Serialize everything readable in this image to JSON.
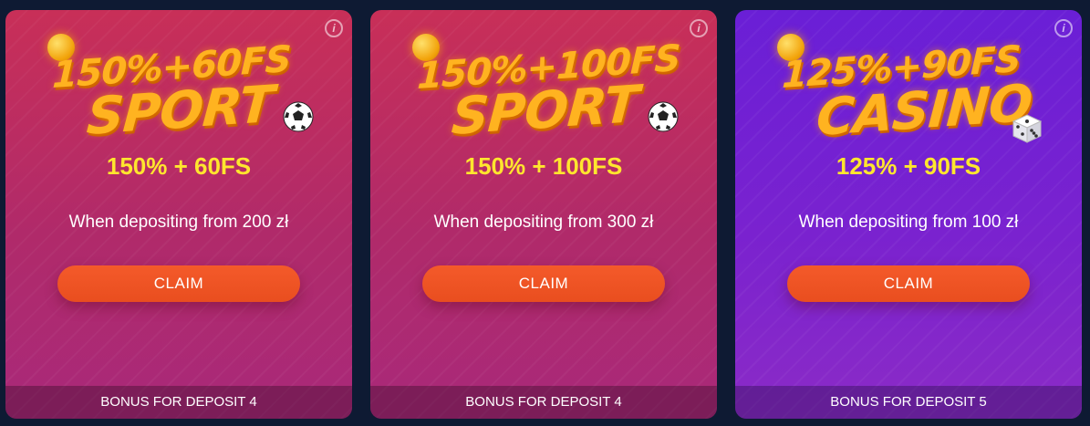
{
  "accent": {
    "headline": "#ffe62e",
    "button": "#f05426",
    "sport_bg": "#c02c64",
    "casino_bg": "#7222d2"
  },
  "bonuses": [
    {
      "theme": "sport",
      "art_top": "150%+60FS",
      "art_bottom": "SPORT",
      "headline": "150% + 60FS",
      "condition": "When depositing from 200 zł",
      "claim_label": "CLAIM",
      "footer": "BONUS FOR DEPOSIT 4",
      "info_icon": "i"
    },
    {
      "theme": "sport",
      "art_top": "150%+100FS",
      "art_bottom": "SPORT",
      "headline": "150% + 100FS",
      "condition": "When depositing from 300 zł",
      "claim_label": "CLAIM",
      "footer": "BONUS FOR DEPOSIT 4",
      "info_icon": "i"
    },
    {
      "theme": "casino",
      "art_top": "125%+90FS",
      "art_bottom": "CASINO",
      "headline": "125% + 90FS",
      "condition": "When depositing from 100 zł",
      "claim_label": "CLAIM",
      "footer": "BONUS FOR DEPOSIT 5",
      "info_icon": "i"
    }
  ]
}
